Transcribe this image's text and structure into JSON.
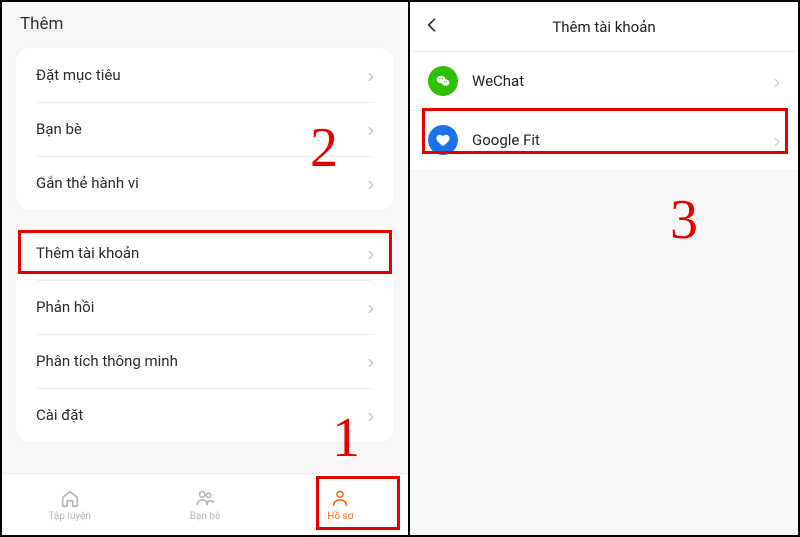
{
  "left": {
    "header": "Thêm",
    "group1": {
      "items": [
        {
          "label": "Đặt mục tiêu"
        },
        {
          "label": "Bạn bè"
        },
        {
          "label": "Gắn thẻ hành vi"
        }
      ]
    },
    "group2": {
      "items": [
        {
          "label": "Thêm tài khoản"
        },
        {
          "label": "Phản hồi"
        },
        {
          "label": "Phân tích thông minh"
        },
        {
          "label": "Cài đặt"
        }
      ]
    },
    "nav": {
      "items": [
        {
          "label": "Tập luyện"
        },
        {
          "label": "Bạn bè"
        },
        {
          "label": "Hồ sơ"
        }
      ]
    }
  },
  "right": {
    "title": "Thêm tài khoản",
    "accounts": [
      {
        "label": "WeChat"
      },
      {
        "label": "Google Fit"
      }
    ]
  },
  "annotations": {
    "n1": "1",
    "n2": "2",
    "n3": "3"
  }
}
